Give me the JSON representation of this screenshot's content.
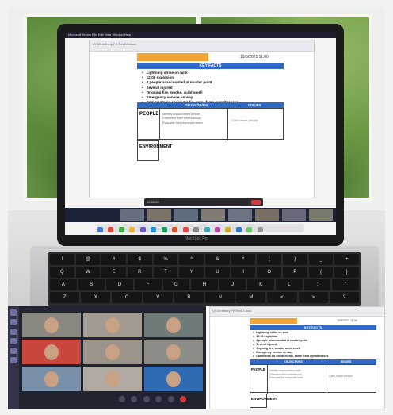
{
  "laptop": {
    "brand_label": "MacBook Pro",
    "menubar_text": "Microsoft Teams  File  Edit  View  Window  Help",
    "doc_title": "LV Oil refinery FH Rev1.1.docx",
    "meeting_time": "02:40:20"
  },
  "document": {
    "date": "19/5/2021 11:00",
    "key_facts_header": "KEY FACTS",
    "key_facts": [
      "Lightning strike on tank",
      "12:00 explosion",
      "4 people unaccounted at muster point",
      "Several injured",
      "Ongoing fire, smoke, acrid smell",
      "Emergency service on way",
      "Comments on social media, some from eyewitnesses"
    ],
    "col_objectives": "OBJECTIVES",
    "col_issues": "ISSUES",
    "row_people_label": "PEOPLE",
    "people_objectives": [
      "Identify unaccounted people",
      "Determine their whereabouts",
      "Evacuate first responder team"
    ],
    "people_issue": "Can't reach people",
    "row_env_label": "ENVIRONMENT"
  },
  "keyboard": {
    "row1": [
      "!",
      "@",
      "#",
      "$",
      "%",
      "^",
      "&",
      "*",
      "(",
      ")",
      "_",
      "+"
    ],
    "row2": [
      "Q",
      "W",
      "E",
      "R",
      "T",
      "Y",
      "U",
      "I",
      "O",
      "P",
      "{",
      "}"
    ],
    "row3": [
      "A",
      "S",
      "D",
      "F",
      "G",
      "H",
      "J",
      "K",
      "L",
      ":",
      "\""
    ],
    "row4": [
      "Z",
      "X",
      "C",
      "V",
      "B",
      "N",
      "M",
      "<",
      ">",
      "?"
    ]
  },
  "colors": {
    "header_blue": "#2f6ac6",
    "accent_orange": "#f4a433",
    "leave_red": "#d23b3b",
    "teams_dark": "#222331"
  }
}
